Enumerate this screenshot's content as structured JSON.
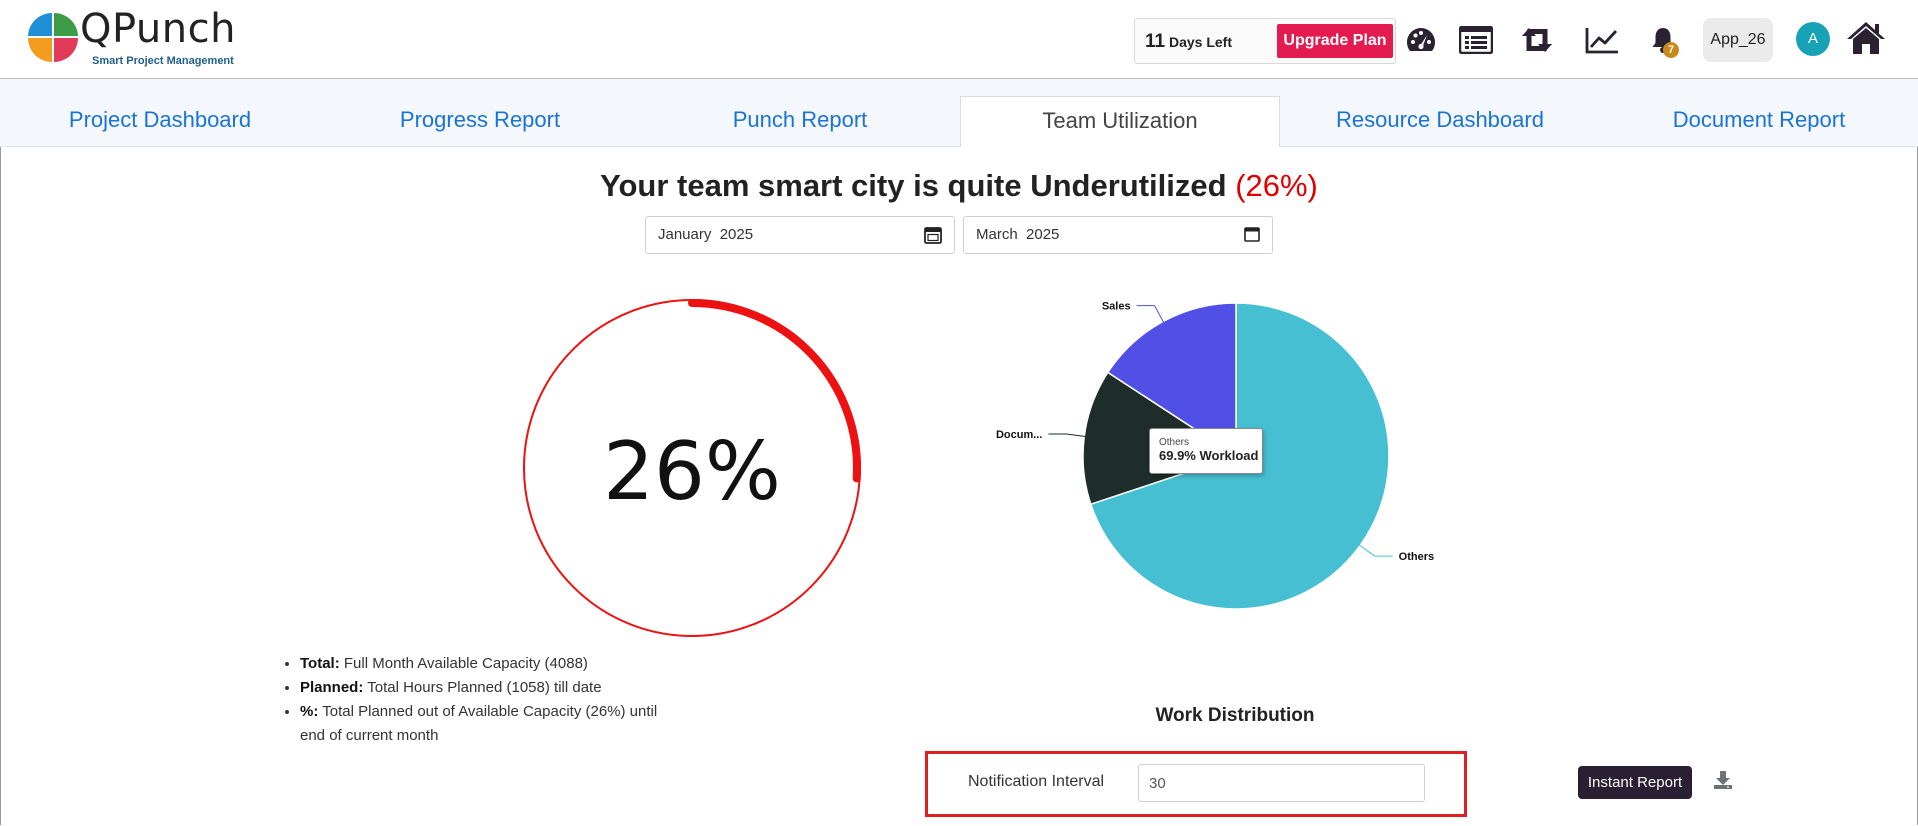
{
  "header": {
    "brand_name": "QPunch",
    "brand_tagline": "Smart Project Management",
    "trial_days": "11",
    "trial_suffix": "Days Left",
    "upgrade_label": "Upgrade Plan",
    "notification_count": "7",
    "app_label": "App_26",
    "avatar_initial": "A",
    "icons": [
      "dashboard-gauge-icon",
      "list-icon",
      "retweet-icon",
      "line-chart-icon",
      "bell-icon",
      "home-icon"
    ]
  },
  "tabs": [
    {
      "label": "Project Dashboard",
      "active": false
    },
    {
      "label": "Progress Report",
      "active": false
    },
    {
      "label": "Punch Report",
      "active": false
    },
    {
      "label": "Team Utilization",
      "active": true
    },
    {
      "label": "Resource Dashboard",
      "active": false
    },
    {
      "label": "Document Report",
      "active": false
    }
  ],
  "main": {
    "headline_prefix": "Your team smart city is quite Underutilized",
    "headline_percent": "(26%)",
    "start_date": "January  2025",
    "end_date": "March  2025",
    "utilization": {
      "value_label": "26%",
      "fraction": 0.26
    },
    "legend": [
      {
        "term": "Total:",
        "text": "Full Month Available Capacity (4088)"
      },
      {
        "term": "Planned:",
        "text": "Total Hours Planned (1058) till date"
      },
      {
        "term": "%:",
        "text": "Total Planned out of Available Capacity (26%) until end of current month"
      }
    ],
    "distribution_title": "Work Distribution",
    "notification_label": "Notification Interval",
    "notification_value": "30",
    "instant_report_label": "Instant Report"
  },
  "chart_data": {
    "type": "pie",
    "title": "Work Distribution",
    "slices": [
      {
        "label": "Others",
        "value": 69.9,
        "color": "#47bfd2"
      },
      {
        "label": "Docum...",
        "value": 14.3,
        "color": "#1e2d29"
      },
      {
        "label": "Sales",
        "value": 15.8,
        "color": "#5050e6"
      }
    ],
    "tooltip": {
      "title": "Others",
      "value": "69.9% Workload"
    }
  },
  "colors": {
    "accent_link": "#1a73d9",
    "upgrade": "#e41b4f",
    "alert_red": "#e00000",
    "dark_button": "#2a1f33",
    "avatar": "#17a2b8"
  }
}
